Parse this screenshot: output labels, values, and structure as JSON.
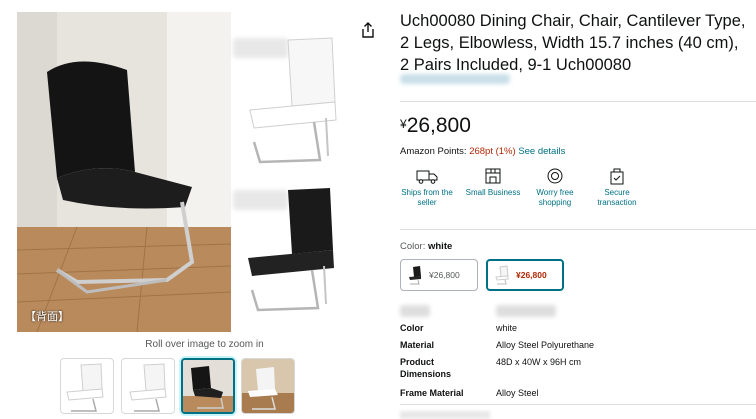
{
  "gallery": {
    "main_caption": "【背面】",
    "zoom_hint": "Roll over image to zoom in",
    "thumbnails": [
      {
        "color": "white",
        "selected": false
      },
      {
        "color": "white",
        "selected": false
      },
      {
        "color": "black",
        "selected": true
      },
      {
        "color": "white",
        "selected": false
      }
    ]
  },
  "product": {
    "title": "Uch00080 Dining Chair, Chair, Cantilever Type, 2 Legs, Elbowless, Width 15.7 inches (40 cm), 2 Pairs Included, 9-1 Uch00080",
    "price_symbol": "¥",
    "price_value": "26,800",
    "points_label": "Amazon Points:",
    "points_value": "268pt",
    "points_pct": "(1%)",
    "points_link": "See details"
  },
  "features": [
    {
      "icon": "truck-icon",
      "label": "Ships from the seller"
    },
    {
      "icon": "store-icon",
      "label": "Small Business"
    },
    {
      "icon": "badge-icon",
      "label": "Worry free shopping"
    },
    {
      "icon": "secure-bag-icon",
      "label": "Secure transaction"
    }
  ],
  "color_selector": {
    "label": "Color:",
    "selected": "white",
    "options": [
      {
        "name": "black",
        "price": "¥26,800",
        "selected": false
      },
      {
        "name": "white",
        "price": "¥26,800",
        "selected": true
      }
    ]
  },
  "specs": [
    {
      "key": "Color",
      "value": "white"
    },
    {
      "key": "Material",
      "value": "Alloy Steel Polyurethane"
    },
    {
      "key": "Product Dimensions",
      "value": "48D x 40W x 96H cm"
    },
    {
      "key": "Frame Material",
      "value": "Alloy Steel"
    }
  ],
  "colors": {
    "link": "#007185",
    "price_red": "#b12704",
    "selected_border": "#007185"
  }
}
